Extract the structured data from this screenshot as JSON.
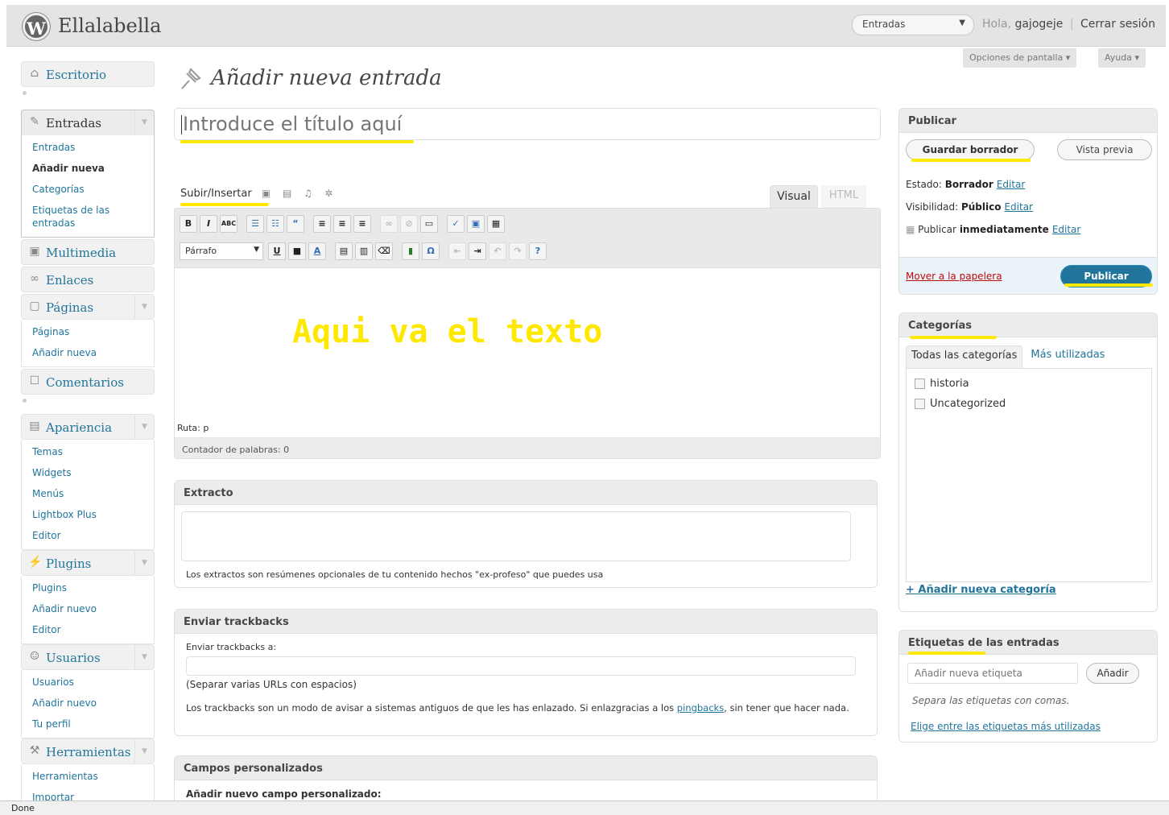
{
  "header": {
    "site_title": "Ellalabella",
    "logo_letter": "W",
    "favorite_actions": {
      "selected": "Entradas"
    },
    "greeting_prefix": "Hola,",
    "username": "gajogeje",
    "separator": "|",
    "logout": "Cerrar sesión"
  },
  "screen_meta": {
    "screen_options": "Opciones de pantalla ▾",
    "help": "Ayuda ▾"
  },
  "menu": {
    "dashboard": "Escritorio",
    "posts": {
      "label": "Entradas",
      "items": [
        "Entradas",
        "Añadir nueva",
        "Categorías",
        "Etiquetas de las entradas"
      ]
    },
    "media": "Multimedia",
    "links": "Enlaces",
    "pages": {
      "label": "Páginas",
      "items": [
        "Páginas",
        "Añadir nueva"
      ]
    },
    "comments": "Comentarios",
    "appearance": {
      "label": "Apariencia",
      "items": [
        "Temas",
        "Widgets",
        "Menús",
        "Lightbox Plus",
        "Editor"
      ]
    },
    "plugins": {
      "label": "Plugins",
      "items": [
        "Plugins",
        "Añadir nuevo",
        "Editor"
      ]
    },
    "users": {
      "label": "Usuarios",
      "items": [
        "Usuarios",
        "Añadir nuevo",
        "Tu perfil"
      ]
    },
    "tools": {
      "label": "Herramientas",
      "items": [
        "Herramientas",
        "Importar"
      ]
    }
  },
  "page": {
    "title": "Añadir nueva entrada",
    "title_placeholder": "Introduce el título aquí"
  },
  "editor": {
    "upload_label": "Subir/Insertar",
    "tab_visual": "Visual",
    "tab_html": "HTML",
    "format_select": "Párrafo",
    "overlay_text": "Aqui va el texto",
    "path": "Ruta: p",
    "word_count": "Contador de palabras: 0"
  },
  "excerpt": {
    "title": "Extracto",
    "help": "Los extractos son resúmenes opcionales de tu contenido hechos \"ex-profeso\" que puedes usa"
  },
  "trackbacks": {
    "title": "Enviar trackbacks",
    "label": "Enviar trackbacks a:",
    "separator_hint": "(Separar varias URLs con espacios)",
    "help_before": "Los trackbacks son un modo de avisar a sistemas antiguos de que les has enlazado. Si enlazgracias a los ",
    "help_link": "pingbacks",
    "help_after": ", sin tener que hacer nada."
  },
  "custom_fields": {
    "title": "Campos personalizados",
    "add_label": "Añadir nuevo campo personalizado:"
  },
  "publish": {
    "title": "Publicar",
    "save_draft": "Guardar borrador",
    "preview": "Vista previa",
    "status_label": "Estado:",
    "status_value": "Borrador",
    "visibility_label": "Visibilidad:",
    "visibility_value": "Público",
    "schedule_label": "Publicar",
    "schedule_value": "inmediatamente",
    "edit": "Editar",
    "trash": "Mover a la papelera",
    "publish_button": "Publicar"
  },
  "categories": {
    "title": "Categorías",
    "tab_all": "Todas las categorías",
    "tab_popular": "Más utilizadas",
    "items": [
      "historia",
      "Uncategorized"
    ],
    "add_new": "+ Añadir nueva categoría"
  },
  "tags": {
    "title": "Etiquetas de las entradas",
    "input_placeholder": "Añadir nueva etiqueta",
    "add_button": "Añadir",
    "hint": "Separa las etiquetas con comas.",
    "choose_popular": "Elige entre las etiquetas más utilizadas"
  },
  "statusbar": {
    "text": "Done"
  },
  "colors": {
    "highlight": "#ffe800",
    "link": "#21759b",
    "publish_button": "#21759b",
    "trash": "#bc0b0b"
  }
}
